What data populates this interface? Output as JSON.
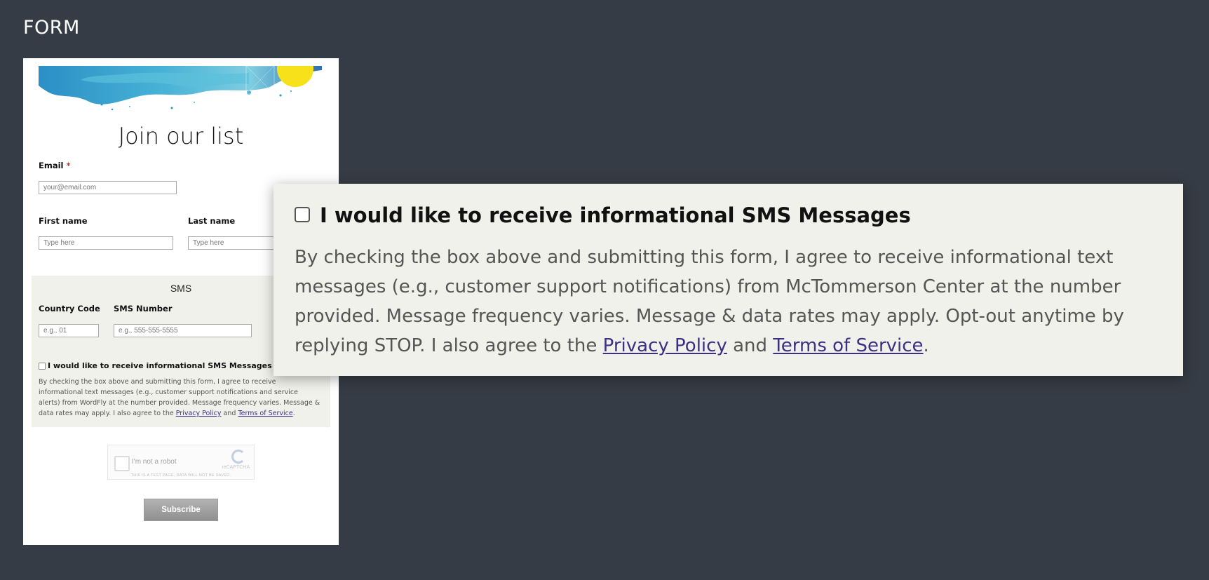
{
  "section_label": "FORM",
  "form": {
    "title": "Join our list",
    "email": {
      "label": "Email",
      "required_mark": "*",
      "placeholder": "your@email.com"
    },
    "first_name": {
      "label": "First name",
      "placeholder": "Type here"
    },
    "last_name": {
      "label": "Last name",
      "placeholder": "Type here"
    },
    "sms": {
      "heading": "SMS",
      "country_code": {
        "label": "Country Code",
        "placeholder": "e.g., 01"
      },
      "sms_number": {
        "label": "SMS Number",
        "placeholder": "e.g., 555-555-5555"
      },
      "consent_title": "I would like to receive informational SMS Messages",
      "consent_text_before": "By checking the box above and submitting this form, I agree to receive informational text messages (e.g., customer support notifications and service alerts) from WordFly at the number provided. Message frequency varies. Message & data rates may apply. I also agree to the ",
      "privacy_link": "Privacy Policy",
      "and": " and ",
      "terms_link": "Terms of Service",
      "period": "."
    },
    "recaptcha": {
      "label": "I'm not a robot",
      "brand": "reCAPTCHA",
      "note": "THIS IS A TEST PAGE, DATA WILL NOT BE SAVED."
    },
    "subscribe_label": "Subscribe"
  },
  "popup": {
    "title": "I would like to receive informational SMS Messages",
    "text_before": "By checking the box above and submitting this form, I agree to receive informational text messages (e.g., customer support notifications) from McTommerson Center at the number provided. Message frequency varies. Message & data rates may apply. Opt-out anytime by replying STOP. I also agree to the ",
    "privacy_link": "Privacy Policy",
    "and": " and ",
    "terms_link": "Terms of Service",
    "period": "."
  },
  "colors": {
    "background": "#363c45",
    "panel": "#f1f1ec",
    "link": "#3d2f83",
    "required": "#d0312d"
  }
}
